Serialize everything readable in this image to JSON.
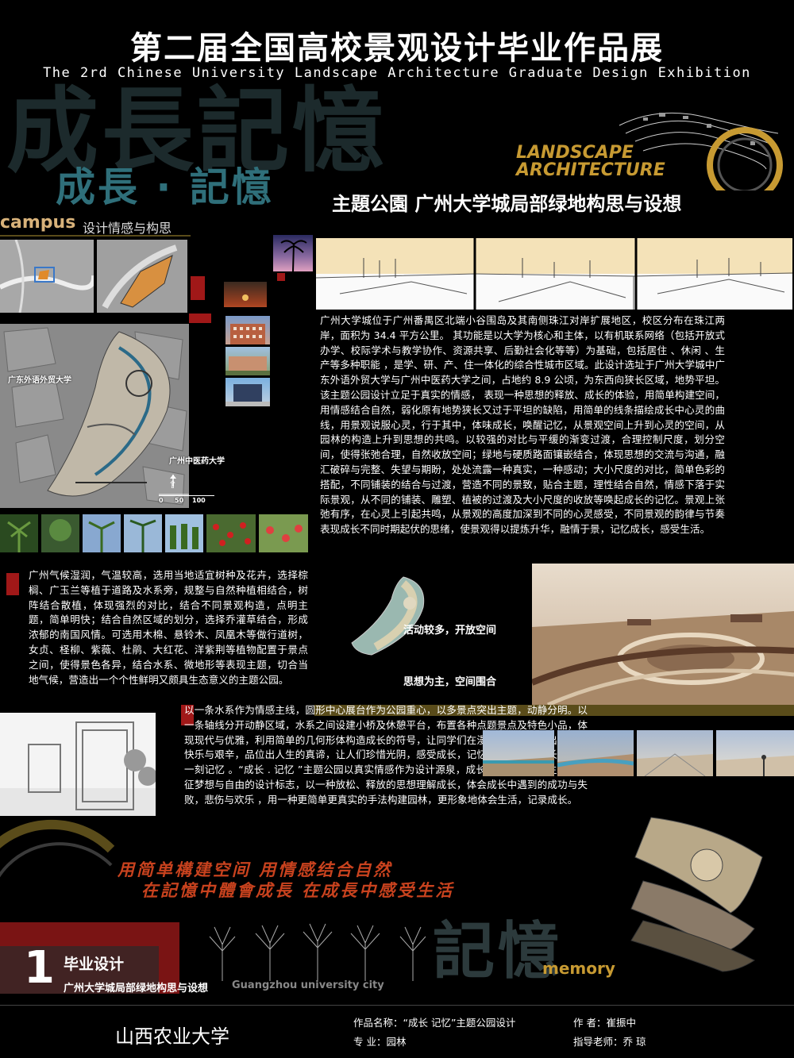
{
  "header": {
    "title_cn": "第二届全国高校景观设计毕业作品展",
    "title_en": "The 2rd Chinese University Landscape Architecture Graduate Design Exhibition"
  },
  "branding": {
    "big_bg_text": "成長記憶",
    "mid_title": "成長 · 記憶",
    "landscape_line1": "LANDSCAPE",
    "landscape_line2": "ARCHITECTURE",
    "park_title": "主題公園  广州大学城局部绿地构思与设想"
  },
  "campus": {
    "label": "campus",
    "subtitle": "设计情感与构思"
  },
  "map_labels": {
    "school_a": "广东外语外贸大学",
    "school_b": "广州中医药大学"
  },
  "paragraphs": {
    "intro": "广州大学城位于广州番禺区北端小谷围岛及其南侧珠江对岸扩展地区，校区分布在珠江两岸，面积为 34.4 平方公里。  其功能是以大学为核心和主体，以有机联系网络（包括开放式办学、校际学术与教学协作、资源共享、后勤社会化等等）为基础，包括居住 、休闲 、生产等多种职能 ，是学、研、产、住一体化的综合性城市区域。此设计选址于广州大学城中广东外语外贸大学与广州中医药大学之间，占地约 8.9 公顷，为东西向狭长区域，地势平坦。该主题公园设计立足于真实的情感， 表现一种思想的释放、成长的体验，用简单构建空间，用情感结合自然，弱化原有地势狭长又过于平坦的缺陷，用简单的线条描绘成长中心灵的曲线，用景观说服心灵，行于其中，体味成长，唤醒记忆，从景观空间上升到心灵的空间，从园林的构造上升到思想的共鸣。以较强的对比与平缓的渐变过渡，合理控制尺度，划分空间，使得张弛合理，自然收放空间；绿地与硬质路面镶嵌结合，体现思想的交流与沟通，融汇破碎与完整、失望与期盼，处处流露一种真实，一种感动；大小尺度的对比，简单色彩的搭配，不同铺装的结合与过渡，营造不同的景致，贴合主题，理性结合自然，情感下落于实际景观，从不同的铺装、雕塑、植被的过渡及大小尺度的收放等唤起成长的记忆。景观上张弛有序，在心灵上引起共鸣，从景观的高度加深到不同的心灵感受，不同景观的韵律与节奏表现成长不同时期起伏的思绪，使景观得以提炼升华，融情于景，记忆成长，感受生活。",
    "plants": "广州气候湿润，气温较高，选用当地适宜树种及花卉，选择棕榈、广玉兰等植于道路及水系旁，规整与自然种植相结合，树阵结合散植，体现强烈的对比，结合不同景观构造，点明主题，简单明快；结合自然区域的划分，选择乔灌草结合，形成浓郁的南国风情。可选用木棉、悬铃木、凤凰木等做行道树，女贞、柽柳、紫薇、杜鹃、大红花、洋紫荆等植物配置于景点之间，使得景色各异，结合水系、微地形等表现主题，切合当地气候，营造出一个个性鲜明又颇具生态意义的主题公园。",
    "water": "以一条水系作为情感主线，圆形中心展台作为公园重心，以多景点突出主题，动静分明。以一条轴线分开动静区域，水系之间设建小桥及休憩平台，布置各种点题景点及特色小品，体现现代与优雅，利用简单的几何形体构造成长的符号，让同学们在漫步时更能体会出成长的快乐与艰辛，品位出人生的真谛，让人们珍惜光阴，感受成长，记忆往事，把留成长中的每一刻记忆  。“成长 . 记忆 ”主题公园以真实情感作为设计源泉，成长历程作为设计主线，象征梦想与自由的设计标志，以一种放松、释放的思想理解成长，体会成长中遇到的成功与失败，悲伤与欢乐 ，用一种更简单更真实的手法构建园林，更形象地体会生活，记录成长。"
  },
  "zone_captions": {
    "active": "活动较多，开放空间",
    "thought": "思想为主，空间围合"
  },
  "slogans": {
    "line1": "用简单構建空间 用情感结合自然",
    "line2": "在記憶中體會成長 在成長中感受生活"
  },
  "footer_brand": {
    "memory_bg": "記憶",
    "memory": "memory",
    "number": "1",
    "grad_label": "毕业设计",
    "grad_sub": "广州大学城局部绿地构思与设想",
    "gz_en": "Guangzhou university city"
  },
  "info": {
    "school": "山西农业大学",
    "work_name": "作品名称：“成长 记忆”主题公园设计",
    "major": "专    业：园林",
    "author": "作     者：崔振中",
    "advisor": "指导老师：乔  琼"
  },
  "scale_bar": {
    "ticks": [
      "0",
      "50",
      "100"
    ]
  },
  "colors": {
    "accent_red": "#a01818",
    "accent_gold": "#c79a32",
    "teal": "#2f6f7a",
    "slogan": "#c8421e"
  }
}
